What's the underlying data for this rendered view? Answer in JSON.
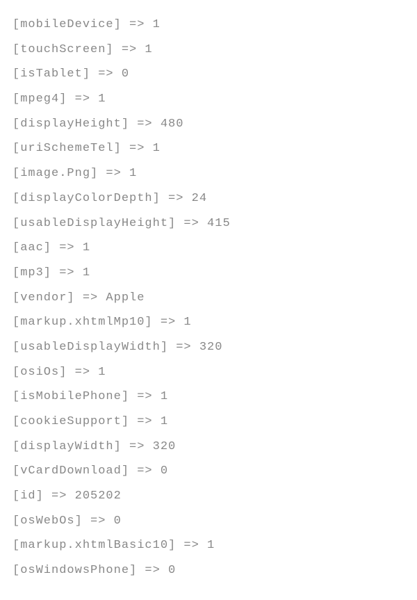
{
  "lines": [
    "[mobileDevice] => 1",
    "[touchScreen] => 1",
    "[isTablet] => 0",
    "[mpeg4] => 1",
    "[displayHeight] => 480",
    "[uriSchemeTel] => 1",
    "[image.Png] => 1",
    "[displayColorDepth] => 24",
    "[usableDisplayHeight] => 415",
    "[aac] => 1",
    "[mp3] => 1",
    "[vendor] => Apple",
    "[markup.xhtmlMp10] => 1",
    "[usableDisplayWidth] => 320",
    "[osiOs] => 1",
    "[isMobilePhone] => 1",
    "[cookieSupport] => 1",
    "[displayWidth] => 320",
    "[vCardDownload] => 0",
    "[id] => 205202",
    "[osWebOs] => 0",
    "[markup.xhtmlBasic10] => 1",
    "[osWindowsPhone] => 0"
  ]
}
